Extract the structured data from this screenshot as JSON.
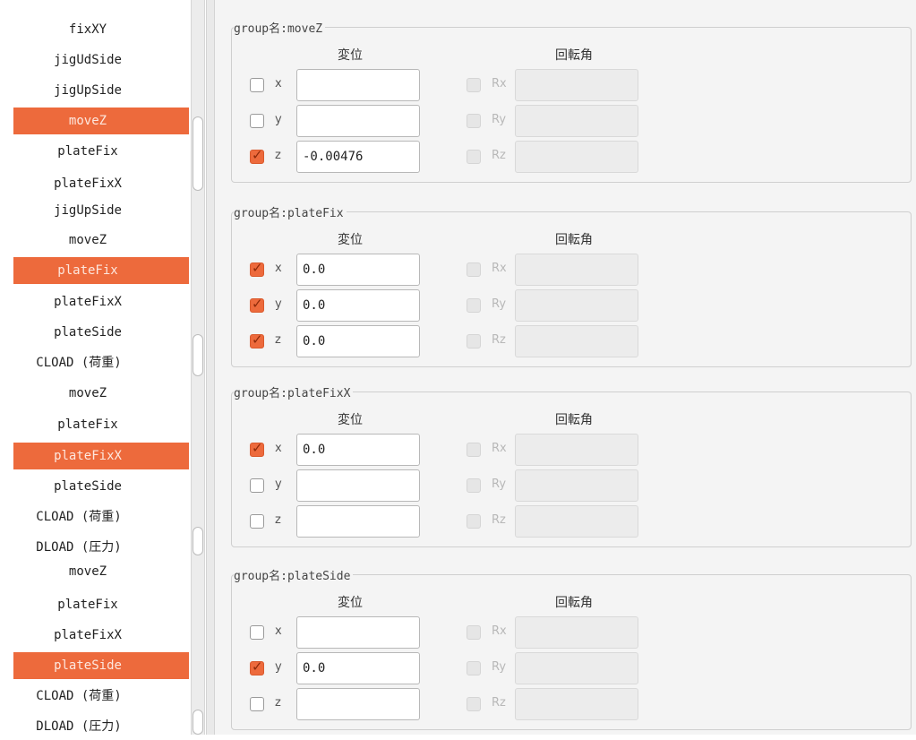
{
  "tree": {
    "items": [
      {
        "label": "fixXY",
        "selected": false
      },
      {
        "label": "jigUdSide",
        "selected": false
      },
      {
        "label": "jigUpSide",
        "selected": false
      },
      {
        "label": "moveZ",
        "selected": true
      },
      {
        "label": "plateFix",
        "selected": false
      },
      {
        "label": "plateFixX",
        "selected": false
      },
      {
        "label": "jigUpSide",
        "selected": false
      },
      {
        "label": "moveZ",
        "selected": false
      },
      {
        "label": "plateFix",
        "selected": true
      },
      {
        "label": "plateFixX",
        "selected": false
      },
      {
        "label": "plateSide",
        "selected": false
      },
      {
        "label": "CLOAD (荷重)",
        "selected": false
      },
      {
        "label": "moveZ",
        "selected": false
      },
      {
        "label": "plateFix",
        "selected": false
      },
      {
        "label": "plateFixX",
        "selected": true
      },
      {
        "label": "plateSide",
        "selected": false
      },
      {
        "label": "CLOAD (荷重)",
        "selected": false
      },
      {
        "label": "DLOAD (圧力)",
        "selected": false
      },
      {
        "label": "moveZ",
        "selected": false
      },
      {
        "label": "plateFix",
        "selected": false
      },
      {
        "label": "plateFixX",
        "selected": false
      },
      {
        "label": "plateSide",
        "selected": true
      },
      {
        "label": "CLOAD (荷重)",
        "selected": false
      },
      {
        "label": "DLOAD (圧力)",
        "selected": false
      }
    ]
  },
  "colors": {
    "selection": "#ed6a3c",
    "panel_bg": "#f4f4f4"
  },
  "columns": {
    "displacement": "変位",
    "rotation": "回転角"
  },
  "groups": [
    {
      "legend": "group名:moveZ",
      "rows": [
        {
          "axis": "x",
          "checked": false,
          "value": "",
          "rot_axis": "Rx"
        },
        {
          "axis": "y",
          "checked": false,
          "value": "",
          "rot_axis": "Ry"
        },
        {
          "axis": "z",
          "checked": true,
          "value": "-0.00476",
          "rot_axis": "Rz"
        }
      ]
    },
    {
      "legend": "group名:plateFix",
      "rows": [
        {
          "axis": "x",
          "checked": true,
          "value": "0.0",
          "rot_axis": "Rx"
        },
        {
          "axis": "y",
          "checked": true,
          "value": "0.0",
          "rot_axis": "Ry"
        },
        {
          "axis": "z",
          "checked": true,
          "value": "0.0",
          "rot_axis": "Rz"
        }
      ]
    },
    {
      "legend": "group名:plateFixX",
      "rows": [
        {
          "axis": "x",
          "checked": true,
          "value": "0.0",
          "rot_axis": "Rx"
        },
        {
          "axis": "y",
          "checked": false,
          "value": "",
          "rot_axis": "Ry"
        },
        {
          "axis": "z",
          "checked": false,
          "value": "",
          "rot_axis": "Rz"
        }
      ]
    },
    {
      "legend": "group名:plateSide",
      "rows": [
        {
          "axis": "x",
          "checked": false,
          "value": "",
          "rot_axis": "Rx"
        },
        {
          "axis": "y",
          "checked": true,
          "value": "0.0",
          "rot_axis": "Ry"
        },
        {
          "axis": "z",
          "checked": false,
          "value": "",
          "rot_axis": "Rz"
        }
      ]
    }
  ]
}
